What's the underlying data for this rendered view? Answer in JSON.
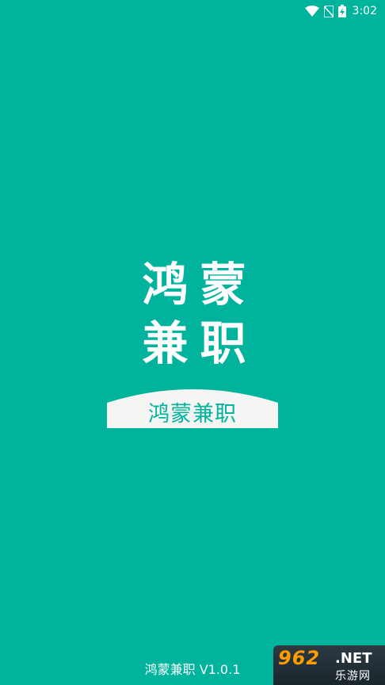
{
  "status_bar": {
    "time": "3:02",
    "icons": [
      "wifi-icon",
      "no-sim-icon",
      "battery-charging-icon"
    ]
  },
  "logo": {
    "characters": [
      "鸿",
      "蒙",
      "兼",
      "职"
    ],
    "banner_text": "鸿蒙兼职"
  },
  "footer": {
    "version_text": "鸿蒙兼职 V1.0.1"
  },
  "watermark": {
    "number": "962",
    "domain": ".NET",
    "subtitle": "乐游网"
  },
  "colors": {
    "background": "#00B39C",
    "banner": "#F5F5F3",
    "watermark_orange": "#FF9C00"
  }
}
